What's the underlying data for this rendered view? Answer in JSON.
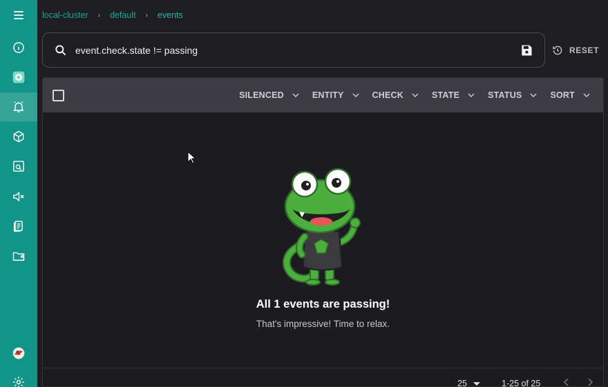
{
  "breadcrumb": {
    "cluster": "local-cluster",
    "namespace": "default",
    "page": "events",
    "separator": "›"
  },
  "search": {
    "query": "event.check.state != passing"
  },
  "reset_label": "RESET",
  "filters": [
    "SILENCED",
    "ENTITY",
    "CHECK",
    "STATE",
    "STATUS",
    "SORT"
  ],
  "empty_state": {
    "title": "All 1 events are passing!",
    "subtitle": "That's impressive! Time to relax."
  },
  "pagination": {
    "per_page": "25",
    "range": "1-25 of 25"
  },
  "nav_icons": [
    "menu-icon",
    "info-icon",
    "namespace-icon",
    "events-bell-icon",
    "entities-cube-icon",
    "checks-icon",
    "silences-mute-icon",
    "handlers-icon",
    "assets-folder-icon",
    "user-avatar",
    "settings-gear-icon"
  ],
  "colors": {
    "rail": "#139488",
    "accent": "#15a397",
    "background": "#1e1e22",
    "toolbar": "#3c3c42"
  }
}
